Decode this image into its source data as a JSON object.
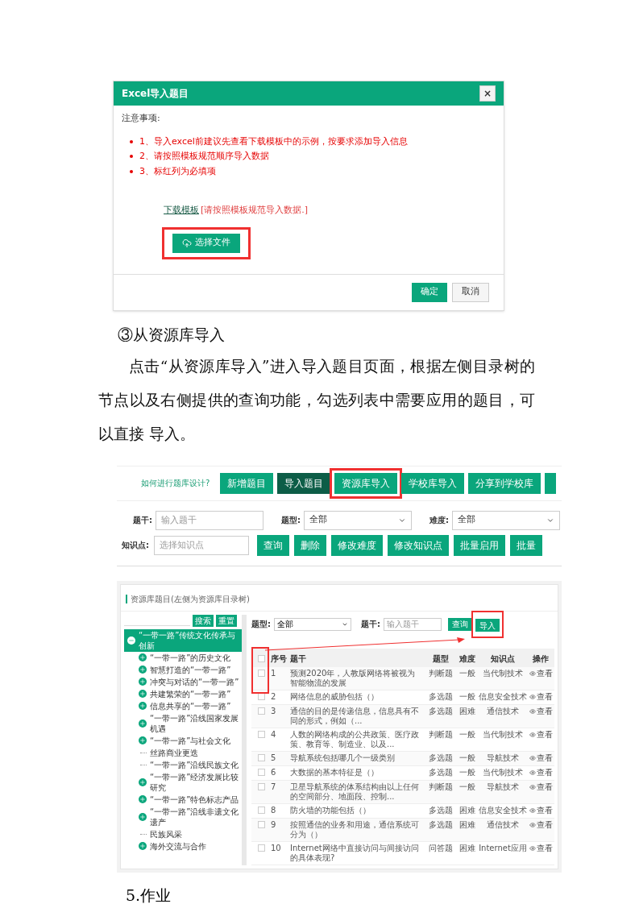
{
  "excel_dialog": {
    "title": "Excel导入题目",
    "close": "×",
    "notes_heading": "注意事项:",
    "notes": [
      "1、导入excel前建议先查看下载模板中的示例，按要求添加导入信息",
      "2、请按照模板规范顺序导入数据",
      "3、标红列为必填项"
    ],
    "template_link": "下载模板",
    "template_hint": "[请按照模板规范导入数据.]",
    "choose_file": "选择文件",
    "confirm": "确定",
    "cancel": "取消"
  },
  "section_heading": "③从资源库导入",
  "paragraph": "点击“从资源库导入”进入导入题目页面，根据左侧目录树的节点以及右侧提供的查询功能，勾选列表中需要应用的题目，可以直接 导入。",
  "toolbar": {
    "help_link": "如何进行题库设计?",
    "tabs": [
      {
        "label": "新增题目",
        "selected": false
      },
      {
        "label": "导入题目",
        "selected": true
      },
      {
        "label": "资源库导入",
        "selected": false,
        "highlighted": true
      },
      {
        "label": "学校库导入",
        "selected": false
      },
      {
        "label": "分享到学校库",
        "selected": false
      }
    ],
    "filters": [
      {
        "label": "题干:",
        "kind": "input",
        "placeholder": "输入题干"
      },
      {
        "label": "题型:",
        "kind": "select",
        "value": "全部"
      },
      {
        "label": "难度:",
        "kind": "select",
        "value": "全部"
      }
    ],
    "knowledge": {
      "label": "知识点:",
      "placeholder": "选择知识点"
    },
    "actions": [
      "查询",
      "删除",
      "修改难度",
      "修改知识点",
      "批量启用",
      "批量"
    ]
  },
  "resource_panel": {
    "title": "资源库题目(左侧为资源库目录树)",
    "search": "搜索",
    "reset": "重置",
    "tree": [
      {
        "label": "“一带一路”传统文化传承与创新",
        "kind": "folder",
        "expanded": true,
        "selected": true,
        "children": [
          {
            "label": "“一带一路”的历史文化",
            "kind": "folder",
            "expanded": false,
            "selected": false
          },
          {
            "label": "智慧打造的“一带一路”",
            "kind": "folder",
            "expanded": false,
            "selected": false
          },
          {
            "label": "冲突与对话的“一带一路”",
            "kind": "folder",
            "expanded": false,
            "selected": false
          },
          {
            "label": "共建繁荣的“一带一路”",
            "kind": "folder",
            "expanded": false,
            "selected": false
          },
          {
            "label": "信息共享的“一带一路”",
            "kind": "folder",
            "expanded": false,
            "selected": false
          },
          {
            "label": "“一带一路”沿线国家发展机遇",
            "kind": "folder",
            "expanded": false,
            "selected": false
          },
          {
            "label": "“一带一路”与社会文化",
            "kind": "folder",
            "expanded": false,
            "selected": false
          },
          {
            "label": "丝路商业更迭",
            "kind": "leaf",
            "selected": false
          },
          {
            "label": "“一带一路”沿线民族文化",
            "kind": "leaf",
            "selected": false
          },
          {
            "label": "“一带一路”经济发展比较研究",
            "kind": "folder",
            "expanded": false,
            "selected": false
          },
          {
            "label": "“一带一路”特色标志产品",
            "kind": "folder",
            "expanded": false,
            "selected": false
          },
          {
            "label": "“一带一路”沿线非遗文化遗产",
            "kind": "folder",
            "expanded": false,
            "selected": false
          },
          {
            "label": "民族风采",
            "kind": "leaf",
            "selected": false
          },
          {
            "label": "海外交流与合作",
            "kind": "folder",
            "expanded": false,
            "selected": false
          }
        ]
      }
    ],
    "type_filter": {
      "label": "题型:",
      "value": "全部"
    },
    "stem_filter": {
      "label": "题干:",
      "placeholder": "输入题干"
    },
    "query": "查询",
    "import": "导入",
    "columns": [
      "序号",
      "题干",
      "题型",
      "难度",
      "知识点",
      "操作"
    ],
    "header_checked": false,
    "rows": [
      {
        "checked": false,
        "cells": [
          "1",
          "预测2020年，人教版网络将被视为智能物流的发展",
          "判断题",
          "一般",
          "当代制技术",
          "查看"
        ]
      },
      {
        "checked": false,
        "cells": [
          "2",
          "网络信息的威胁包括（）",
          "多选题",
          "一般",
          "信息安全技术",
          "查看"
        ]
      },
      {
        "checked": false,
        "cells": [
          "3",
          "通信的目的是传递信息，信息具有不同的形式，例如（...",
          "多选题",
          "困难",
          "通信技术",
          "查看"
        ]
      },
      {
        "checked": false,
        "cells": [
          "4",
          "人数的网络构成的公共政策、医疗政策、教育等、制造业、以及...",
          "判断题",
          "一般",
          "当代制技术",
          "查看"
        ]
      },
      {
        "checked": false,
        "cells": [
          "5",
          "导航系统包括哪几个一级类别",
          "多选题",
          "一般",
          "导航技术",
          "查看"
        ]
      },
      {
        "checked": false,
        "cells": [
          "6",
          "大数据的基本特征是（）",
          "多选题",
          "一般",
          "当代制技术",
          "查看"
        ]
      },
      {
        "checked": false,
        "cells": [
          "7",
          "卫星导航系统的体系结构由以上任何的空间部分、地面段、控制...",
          "判断题",
          "一般",
          "导航技术",
          "查看"
        ]
      },
      {
        "checked": false,
        "cells": [
          "8",
          "防火墙的功能包括（）",
          "多选题",
          "困难",
          "信息安全技术",
          "查看"
        ]
      },
      {
        "checked": false,
        "cells": [
          "9",
          "按照通信的业务和用途，通信系统可分为（）",
          "多选题",
          "困难",
          "通信技术",
          "查看"
        ]
      },
      {
        "checked": false,
        "cells": [
          "10",
          "Internet网络中直接访问与间接访问的具体表现?",
          "问答题",
          "困难",
          "Internet应用",
          "查看"
        ]
      }
    ]
  },
  "next_heading": "5.作业"
}
